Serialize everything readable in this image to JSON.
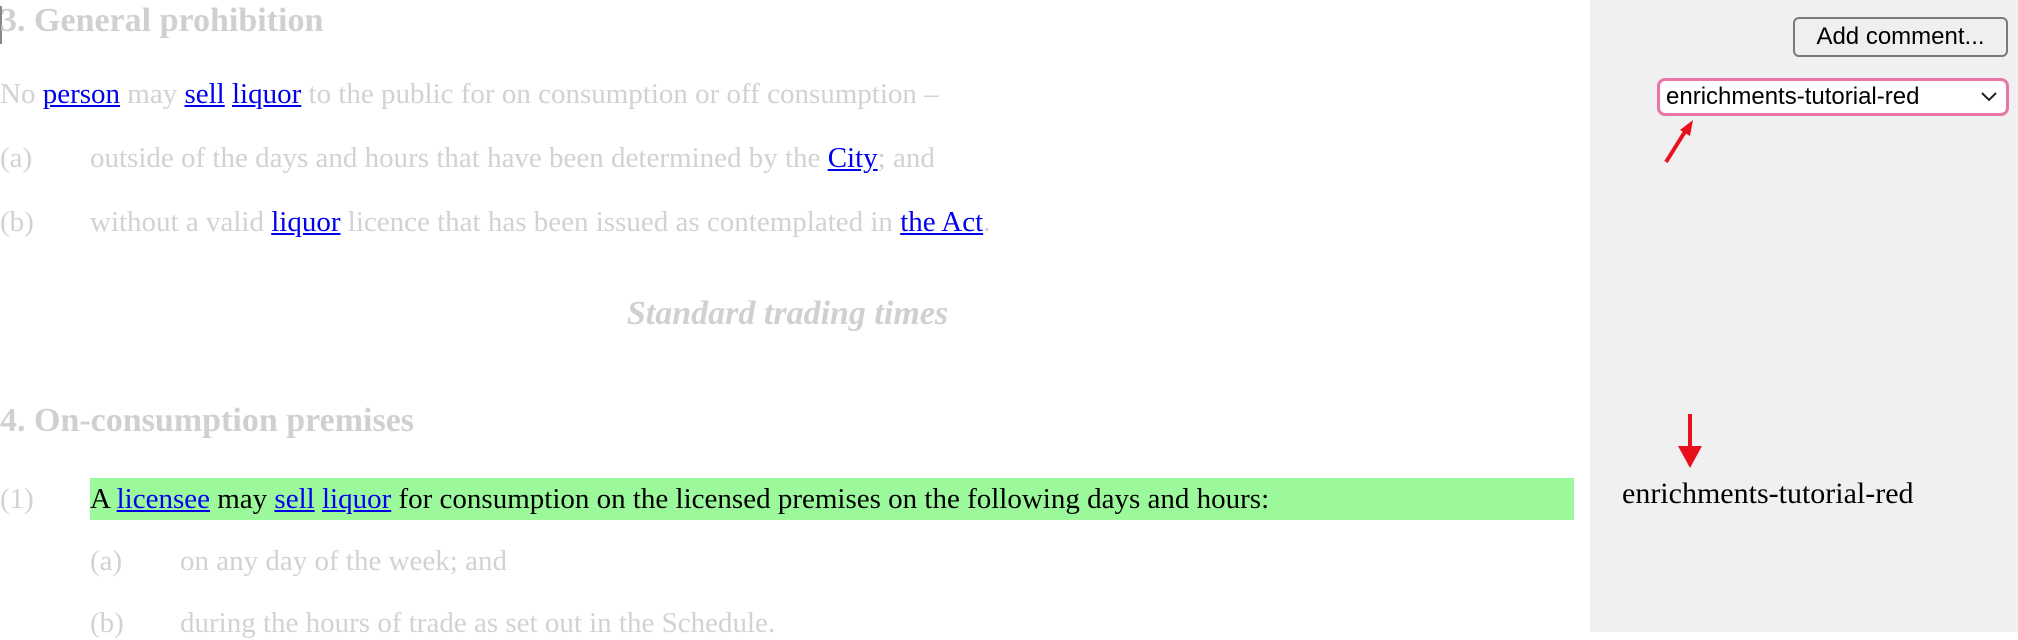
{
  "section3": {
    "heading": "3. General prohibition",
    "intro": {
      "w1": "No",
      "t1": "person",
      "w2": "may",
      "t2": "sell",
      "t3": "liquor",
      "w3": "to the public for on consumption or off consumption –"
    },
    "items": [
      {
        "num": "(a)",
        "pre": "outside of the days and hours that have been determined by the",
        "term": "City",
        "post": "; and"
      },
      {
        "num": "(b)",
        "pre": "without a valid",
        "term": "liquor",
        "mid": "licence that has been issued as contemplated in",
        "term2": "the Act",
        "post": "."
      }
    ]
  },
  "subtitle": "Standard trading times",
  "section4": {
    "heading": "4. On-consumption premises",
    "para1": {
      "num": "(1)",
      "w1": "A",
      "t1": "licensee",
      "w2": "may",
      "t2": "sell",
      "t3": "liquor",
      "w3": "for consumption on the licensed premises on the following days and hours:"
    },
    "subitems": [
      {
        "num": "(a)",
        "text": "on any day of the week; and"
      },
      {
        "num": "(b)",
        "text": "during the hours of trade as set out in the Schedule."
      }
    ]
  },
  "sidebar": {
    "add_comment": "Add comment...",
    "selected_enrichment": "enrichments-tutorial-red",
    "enrichment_tag": "enrichments-tutorial-red"
  },
  "colors": {
    "highlight": "#9cf99b",
    "select_border": "#e876a8",
    "arrow": "#e8101a"
  }
}
